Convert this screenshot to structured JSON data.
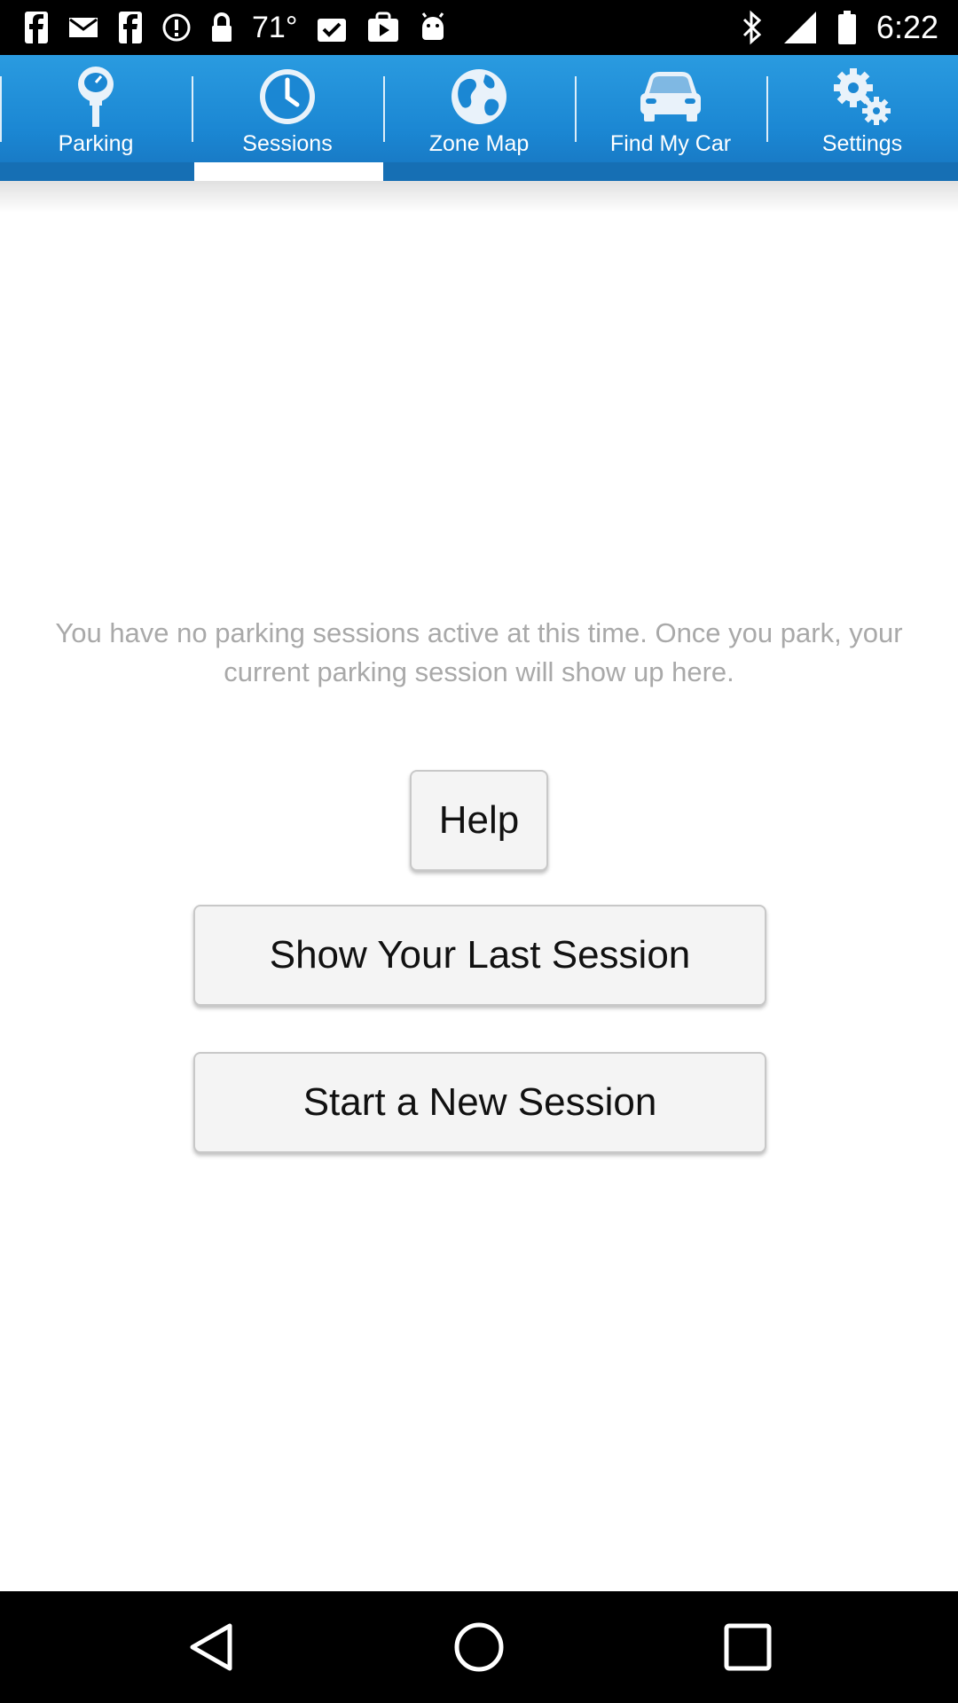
{
  "status_bar": {
    "temperature": "71°",
    "time": "6:22"
  },
  "tabs": [
    {
      "label": "Parking",
      "icon": "parking-meter-icon"
    },
    {
      "label": "Sessions",
      "icon": "clock-icon",
      "active": true
    },
    {
      "label": "Zone Map",
      "icon": "globe-icon"
    },
    {
      "label": "Find My Car",
      "icon": "car-icon"
    },
    {
      "label": "Settings",
      "icon": "gears-icon"
    }
  ],
  "main": {
    "empty_message": "You have no parking sessions active at this time.  Once you park, your current parking session will show up here.",
    "help_label": "Help",
    "last_session_label": "Show Your Last Session",
    "new_session_label": "Start a New Session"
  },
  "colors": {
    "tab_bar": "#1b87d3",
    "message_text": "#a9a9a9"
  }
}
